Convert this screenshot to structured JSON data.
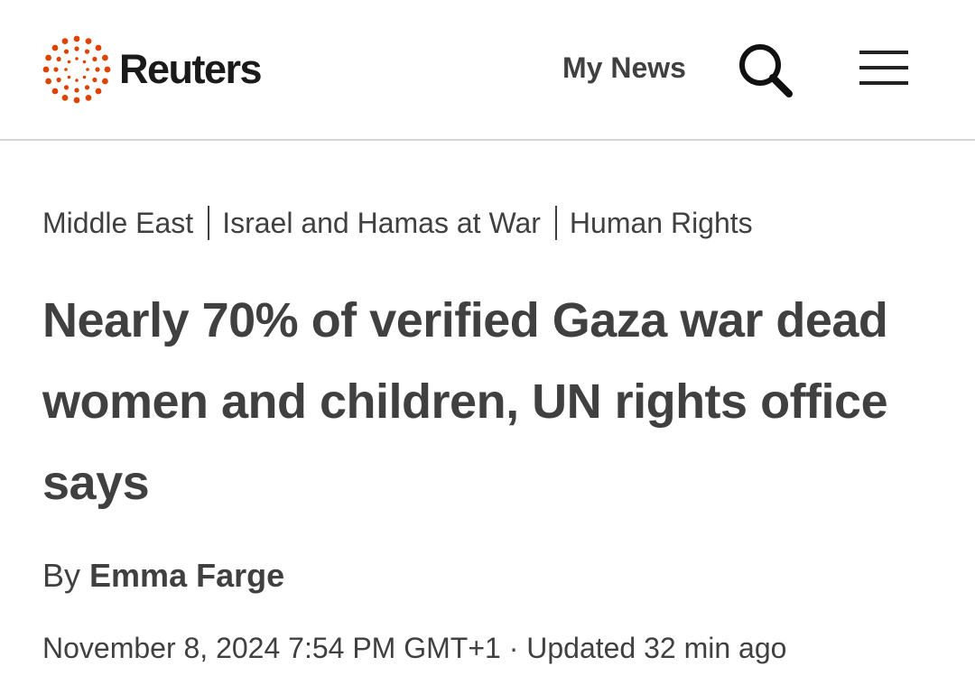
{
  "header": {
    "brand": "Reuters",
    "my_news_label": "My News",
    "search_icon": "search-icon",
    "menu_icon": "hamburger-menu-icon",
    "brand_color": "#dc4300"
  },
  "breadcrumbs": [
    {
      "label": "Middle East"
    },
    {
      "label": "Israel and Hamas at War"
    },
    {
      "label": "Human Rights"
    }
  ],
  "article": {
    "headline": "Nearly 70% of verified Gaza war dead women and children, UN rights office says",
    "byline_prefix": "By",
    "author": "Emma Farge",
    "date": "November 8, 2024 7:54 PM GMT+1",
    "separator": "·",
    "updated": "Updated 32 min ago"
  }
}
